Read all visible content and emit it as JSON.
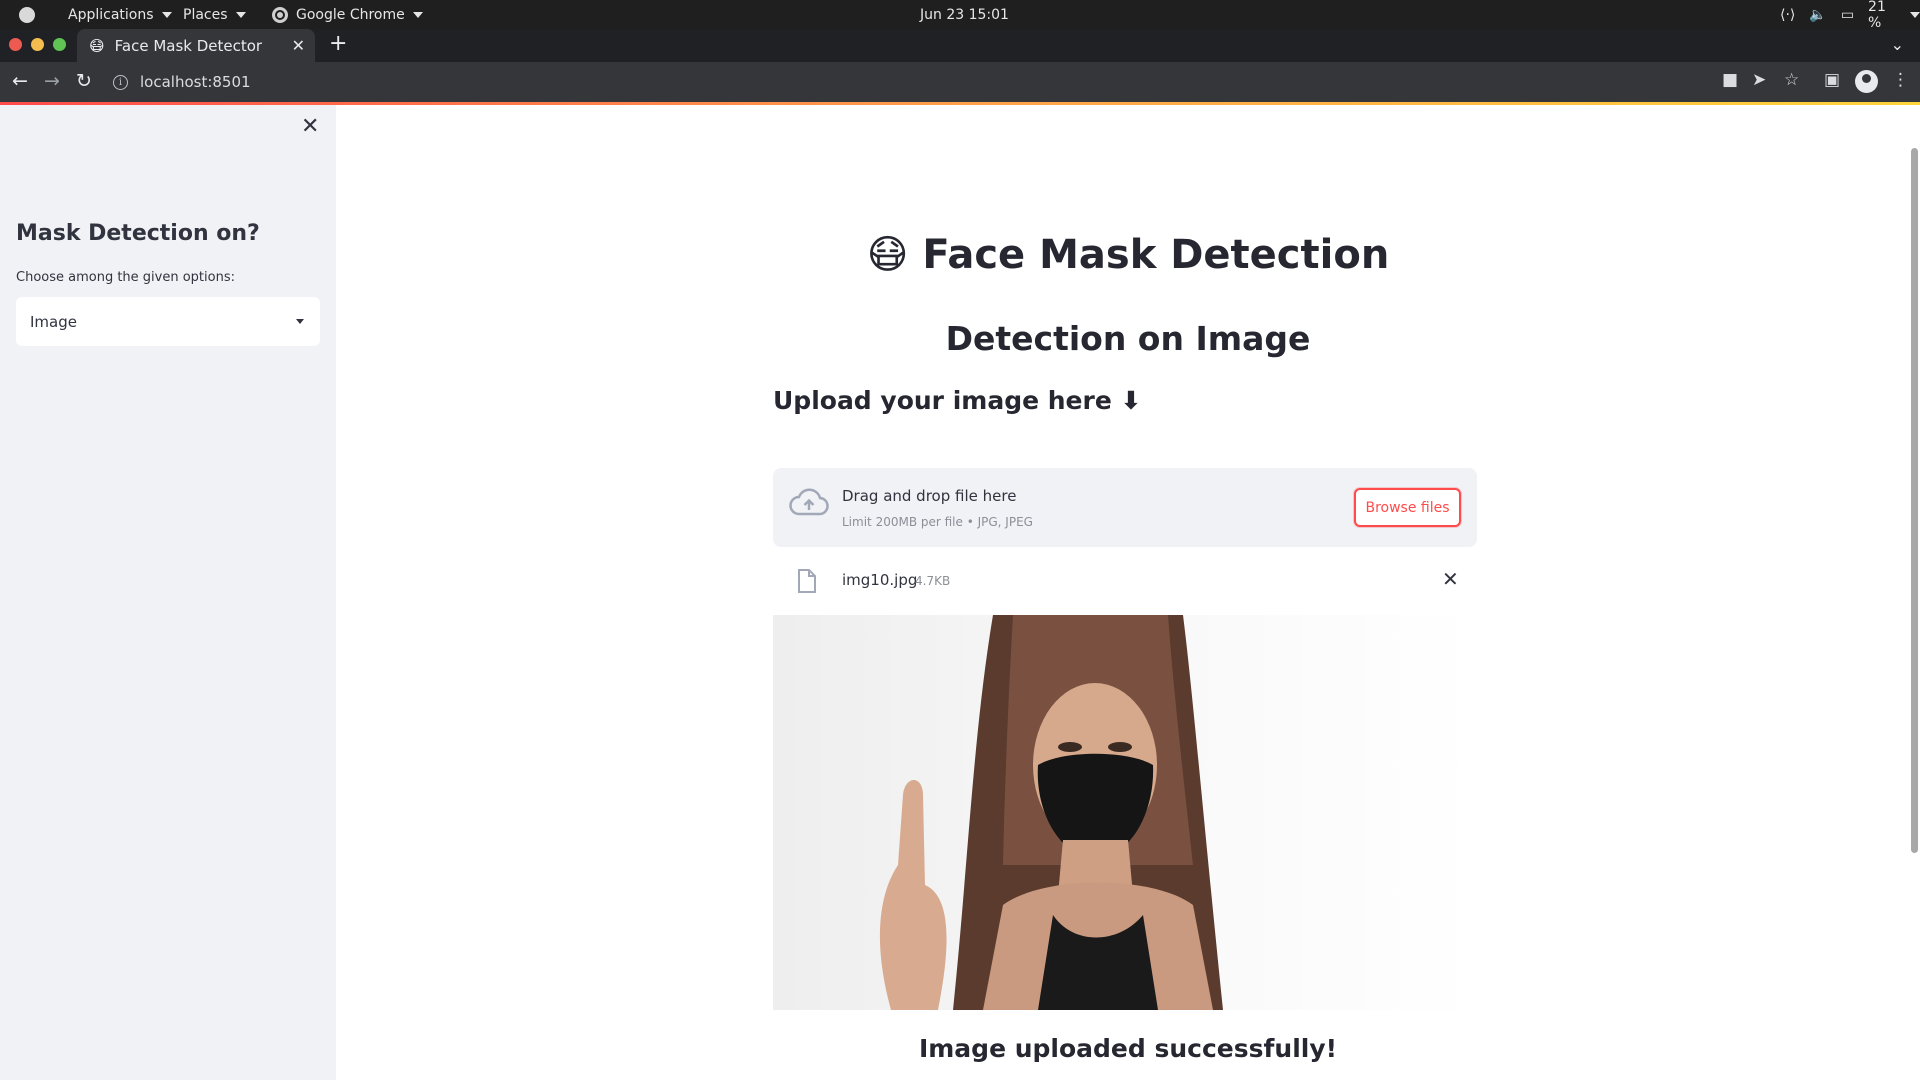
{
  "os_topbar": {
    "apps_label": "Applications",
    "places_label": "Places",
    "browser_label": "Google Chrome",
    "datetime": "Jun 23  15:01",
    "battery": "21 %"
  },
  "browser": {
    "tab_title": "Face Mask Detector",
    "tab_favicon": "😷",
    "url": "localhost:8501"
  },
  "sidebar": {
    "heading": "Mask Detection on?",
    "select_label": "Choose among the given options:",
    "selected_option": "Image"
  },
  "main": {
    "title_emoji": "😷",
    "title": "Face Mask Detection",
    "subtitle": "Detection on Image",
    "upload_heading": "Upload your image here ⬇",
    "dropzone": {
      "main_text": "Drag and drop file here",
      "sub_text": "Limit 200MB per file • JPG, JPEG",
      "browse_label": "Browse files"
    },
    "file": {
      "name": "img10.jpg",
      "size": "4.7KB"
    },
    "success_message": "Image uploaded successfully!"
  },
  "colors": {
    "accent": "#ff4b4b",
    "sidebar_bg": "#f0f2f6",
    "text": "#31333f"
  }
}
